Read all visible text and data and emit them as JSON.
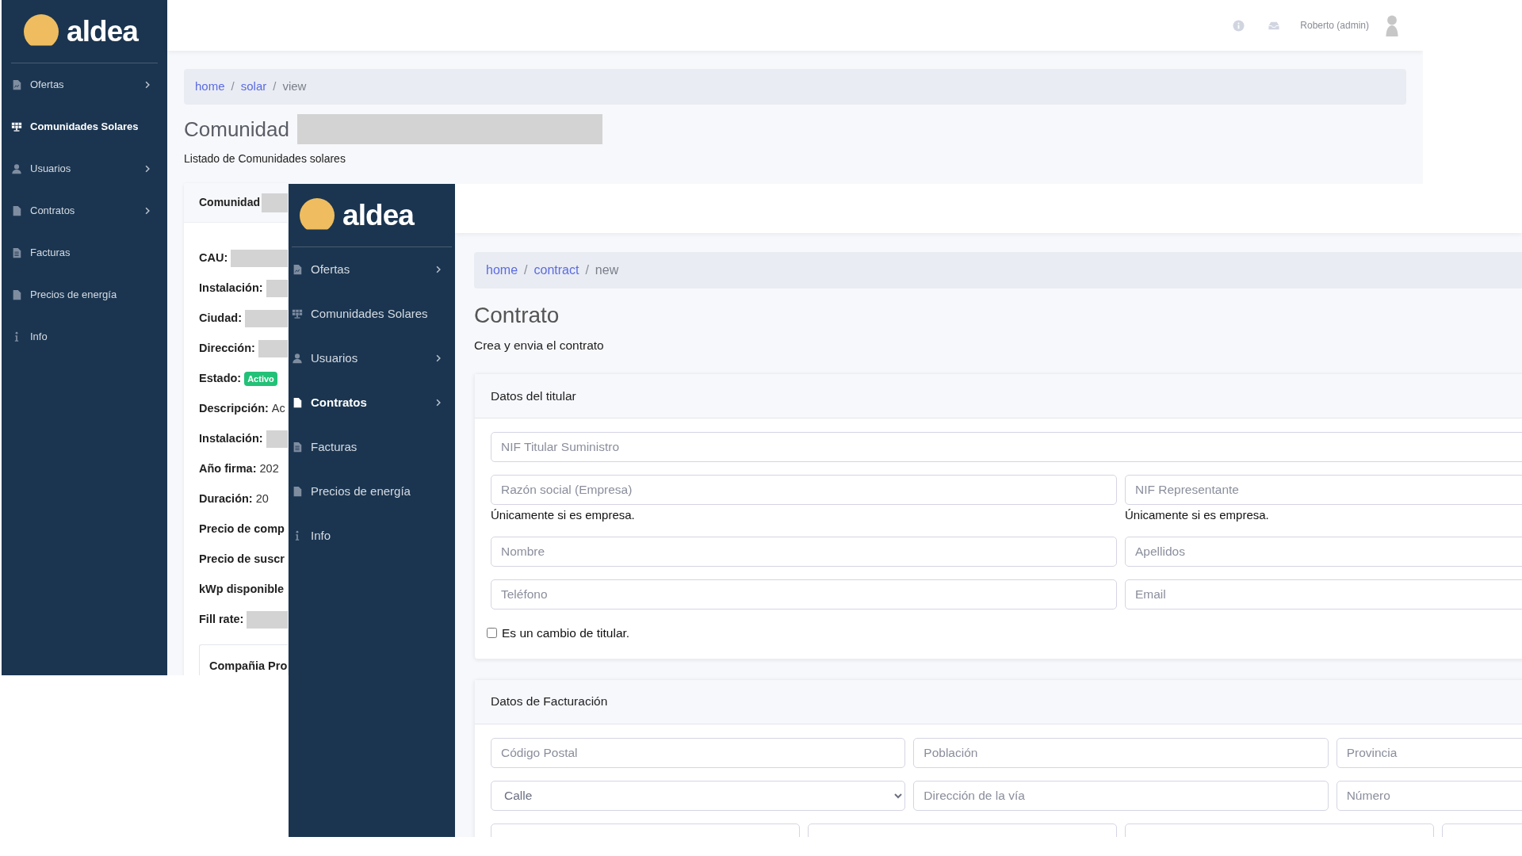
{
  "back_window": {
    "logo": "aldea",
    "sidebar": {
      "items": [
        {
          "label": "Ofertas",
          "selected": false,
          "expandable": true
        },
        {
          "label": "Comunidades Solares",
          "selected": true,
          "expandable": false
        },
        {
          "label": "Usuarios",
          "selected": false,
          "expandable": true
        },
        {
          "label": "Contratos",
          "selected": false,
          "expandable": true
        },
        {
          "label": "Facturas",
          "selected": false,
          "expandable": false
        },
        {
          "label": "Precios de energía",
          "selected": false,
          "expandable": false
        },
        {
          "label": "Info",
          "selected": false,
          "expandable": false
        }
      ]
    },
    "topbar": {
      "user": "Roberto (admin)"
    },
    "breadcrumb": [
      {
        "label": "home",
        "kind": "link"
      },
      {
        "label": "/",
        "kind": "separator"
      },
      {
        "label": "solar",
        "kind": "link"
      },
      {
        "label": "/",
        "kind": "separator"
      },
      {
        "label": "view",
        "kind": "current"
      }
    ],
    "title": "Comunidad",
    "subtitle": "Listado de Comunidades solares",
    "card": {
      "title": "Comunidad",
      "fields": [
        {
          "label": "CAU:",
          "kind": "redacted"
        },
        {
          "label": "Instalación:",
          "kind": "redacted"
        },
        {
          "label": "Ciudad:",
          "kind": "redacted"
        },
        {
          "label": "Dirección:",
          "kind": "redacted"
        },
        {
          "label": "Estado:",
          "kind": "badge",
          "value": "Activo"
        },
        {
          "label": "Descripción:",
          "kind": "text",
          "value": "Ac"
        },
        {
          "label": "Instalación:",
          "kind": "redacted"
        },
        {
          "label": "Año firma:",
          "kind": "text",
          "value": "202"
        },
        {
          "label": "Duración:",
          "kind": "text",
          "value": "20"
        },
        {
          "label": "Precio de comp",
          "kind": "label_only"
        },
        {
          "label": "Precio de suscr",
          "kind": "label_only"
        },
        {
          "label": "kWp disponible",
          "kind": "label_only"
        },
        {
          "label": "Fill rate:",
          "kind": "redacted"
        }
      ],
      "inner_box": {
        "title": "Compañia Pro"
      }
    }
  },
  "front_window": {
    "logo": "aldea",
    "sidebar": {
      "items": [
        {
          "label": "Ofertas",
          "selected": false,
          "expandable": true
        },
        {
          "label": "Comunidades Solares",
          "selected": false,
          "expandable": false
        },
        {
          "label": "Usuarios",
          "selected": false,
          "expandable": true
        },
        {
          "label": "Contratos",
          "selected": true,
          "expandable": true
        },
        {
          "label": "Facturas",
          "selected": false,
          "expandable": false
        },
        {
          "label": "Precios de energía",
          "selected": false,
          "expandable": false
        },
        {
          "label": "Info",
          "selected": false,
          "expandable": false
        }
      ]
    },
    "breadcrumb": [
      {
        "label": "home",
        "kind": "link"
      },
      {
        "label": "/",
        "kind": "separator"
      },
      {
        "label": "contract",
        "kind": "link"
      },
      {
        "label": "/",
        "kind": "separator"
      },
      {
        "label": "new",
        "kind": "current"
      }
    ],
    "title": "Contrato",
    "subtitle": "Crea y envia el contrato",
    "cards": [
      {
        "title": "Datos del titular",
        "rows": [
          [
            {
              "kind": "input",
              "placeholder": "NIF Titular Suministro"
            }
          ],
          [
            {
              "kind": "input",
              "placeholder": "Razón social (Empresa)",
              "help": "Únicamente si es empresa."
            },
            {
              "kind": "input",
              "placeholder": "NIF Representante",
              "help": "Únicamente si es empresa."
            }
          ],
          [
            {
              "kind": "input",
              "placeholder": "Nombre"
            },
            {
              "kind": "input",
              "placeholder": "Apellidos"
            }
          ],
          [
            {
              "kind": "input",
              "placeholder": "Teléfono"
            },
            {
              "kind": "input",
              "placeholder": "Email"
            }
          ]
        ],
        "checkbox": {
          "label": "Es un cambio de titular.",
          "checked": false
        }
      },
      {
        "title": "Datos de Facturación",
        "rows": [
          [
            {
              "kind": "input",
              "placeholder": "Código Postal"
            },
            {
              "kind": "input",
              "placeholder": "Población"
            },
            {
              "kind": "input",
              "placeholder": "Provincia"
            }
          ],
          [
            {
              "kind": "select",
              "value": "Calle"
            },
            {
              "kind": "input",
              "placeholder": "Dirección de la vía"
            },
            {
              "kind": "input",
              "placeholder": "Número"
            }
          ],
          [
            {
              "kind": "input"
            },
            {
              "kind": "input"
            },
            {
              "kind": "input"
            },
            {
              "kind": "input"
            }
          ]
        ]
      }
    ]
  }
}
